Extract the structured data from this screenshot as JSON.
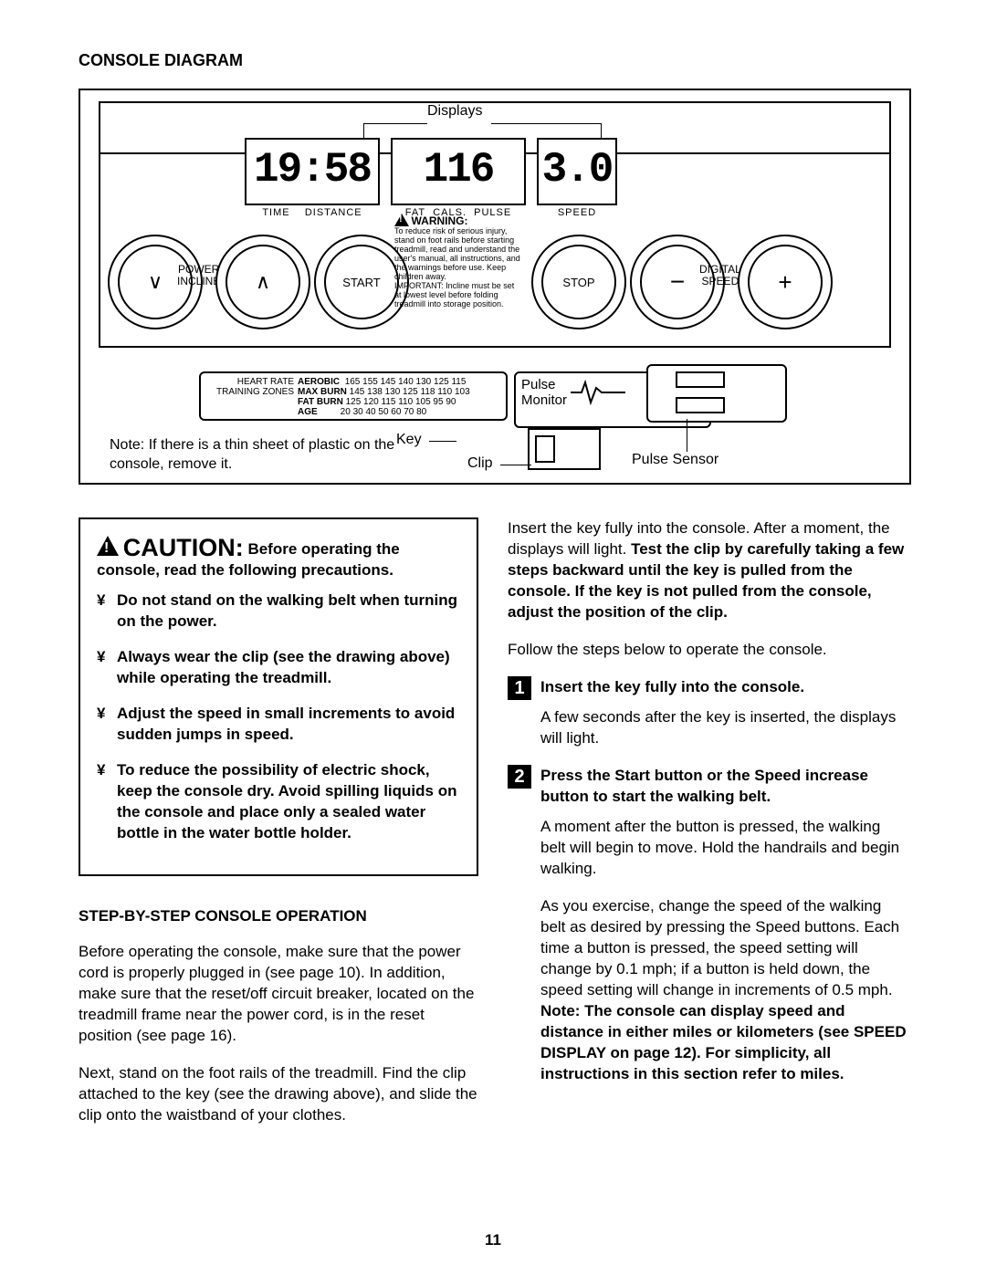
{
  "page_number": "11",
  "title": "CONSOLE DIAGRAM",
  "diagram": {
    "callouts": {
      "displays": "Displays",
      "key": "Key",
      "clip": "Clip",
      "pulse_monitor": "Pulse\nMonitor",
      "pulse_sensor": "Pulse Sensor"
    },
    "note": "Note: If there is a thin sheet of plastic on the console, remove it.",
    "display_values": {
      "time_distance": "19:58",
      "fat_cals_pulse": "116",
      "speed": "3.0"
    },
    "display_labels": {
      "time": "TIME",
      "distance": "DISTANCE",
      "fat": "FAT",
      "cals": "CALS.",
      "pulse": "PULSE",
      "speed": "SPEED"
    },
    "buttons": {
      "incline_down_glyph": "∨",
      "incline_up_glyph": "∧",
      "power_incline": "POWER\nINCLINE",
      "start": "START",
      "stop": "STOP",
      "speed_down_glyph": "−",
      "speed_up_glyph": "+",
      "digital_speed": "DIGITAL\nSPEED"
    },
    "warning": {
      "title": "WARNING:",
      "body": "To reduce risk of serious injury, stand on foot rails before starting treadmill, read and understand the user's manual, all instructions, and the warnings before use. Keep children away.",
      "important": "IMPORTANT: Incline must be set at lowest level before folding treadmill into storage position."
    },
    "training_zones": {
      "heading": "HEART RATE TRAINING ZONES",
      "rows": [
        {
          "label": "AEROBIC",
          "vals": "165  155  145  140  130  125  115"
        },
        {
          "label": "MAX BURN",
          "vals": "145  138  130  125  118  110  103"
        },
        {
          "label": "FAT BURN",
          "vals": "125  120  115  110  105   95   90"
        },
        {
          "label": "AGE",
          "vals": " 20   30   40   50   60   70   80"
        }
      ]
    }
  },
  "caution": {
    "heading_word": "CAUTION:",
    "heading_rest": "Before operating the console, read the following precautions.",
    "bullets": [
      "Do not stand on the walking belt when turning on the power.",
      "Always wear the clip (see the drawing above) while operating the treadmill.",
      "Adjust the speed in small increments to avoid sudden jumps in speed.",
      "To reduce the possibility of electric shock, keep the console dry. Avoid spilling liquids on the console and place only a sealed water bottle in the water bottle holder."
    ]
  },
  "operation": {
    "heading": "STEP-BY-STEP CONSOLE OPERATION",
    "para1": "Before operating the console, make sure that the power cord is properly plugged in (see page 10). In addition, make sure that the reset/off circuit breaker, located on the treadmill frame near the power cord, is in the reset position (see page 16).",
    "para2": "Next, stand on the foot rails of the treadmill. Find the clip attached to the key (see the drawing above), and slide the clip onto the waistband of your clothes."
  },
  "right": {
    "para1a": "Insert the key fully into the console. After a moment, the displays will light. ",
    "para1b": "Test the clip by carefully taking a few steps backward until the key is pulled from the console. If the key is not pulled from the console, adjust the position of the clip.",
    "para2": "Follow the steps below to operate the console.",
    "steps": [
      {
        "num": "1",
        "title": "Insert the key fully into the console.",
        "body": "A few seconds after the key is inserted, the displays will light."
      },
      {
        "num": "2",
        "title": "Press the Start button or the Speed increase button to start the walking belt.",
        "body1": "A moment after the button is pressed, the walking belt will begin to move. Hold the handrails and begin walking.",
        "body2a": "As you exercise, change the speed of the walking belt as desired by pressing the Speed buttons. Each time a button is pressed, the speed setting will change by 0.1 mph; if a button is held down, the speed setting will change in increments of 0.5 mph. ",
        "body2b": "Note: The console can display speed and distance in either miles or kilometers (see SPEED DISPLAY on page 12). For simplicity, all instructions in this section refer to miles."
      }
    ]
  }
}
